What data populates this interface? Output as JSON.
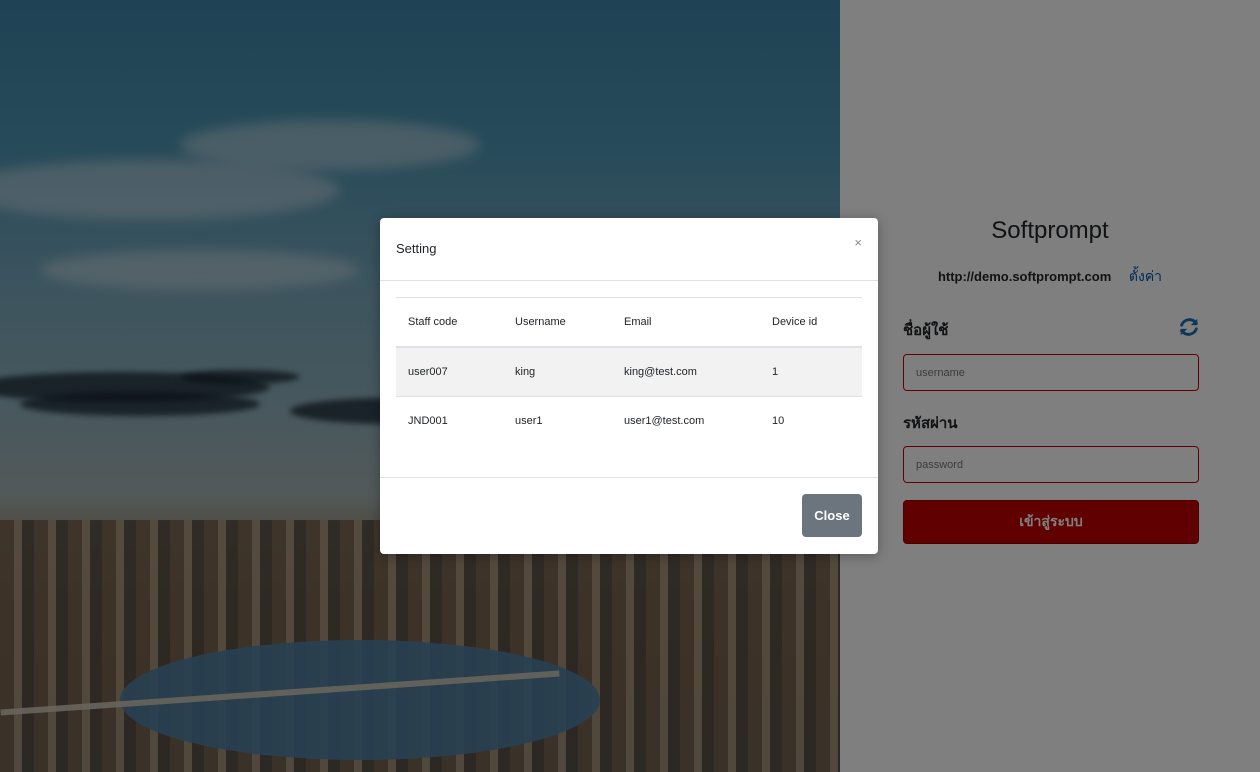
{
  "login": {
    "brand": "Softprompt",
    "server_url": "http://demo.softprompt.com",
    "settings_link": "ตั้งค่า",
    "username_label": "ชื่อผู้ใช้",
    "username_placeholder": "username",
    "password_label": "รหัสผ่าน",
    "password_placeholder": "password",
    "login_button": "เข้าสู่ระบบ",
    "refresh_icon": "refresh-icon"
  },
  "modal": {
    "title": "Setting",
    "close_x": "×",
    "close_button": "Close",
    "table": {
      "headers": [
        "Staff code",
        "Username",
        "Email",
        "Device id"
      ],
      "rows": [
        [
          "user007",
          "king",
          "king@test.com",
          "1"
        ],
        [
          "JND001",
          "user1",
          "user1@test.com",
          "10"
        ]
      ]
    }
  },
  "colors": {
    "login_button": "#c00000",
    "settings_link": "#0056b3",
    "input_border": "#cc0000",
    "close_button": "#6c757d",
    "backdrop": "rgba(0,0,0,0.5)"
  }
}
